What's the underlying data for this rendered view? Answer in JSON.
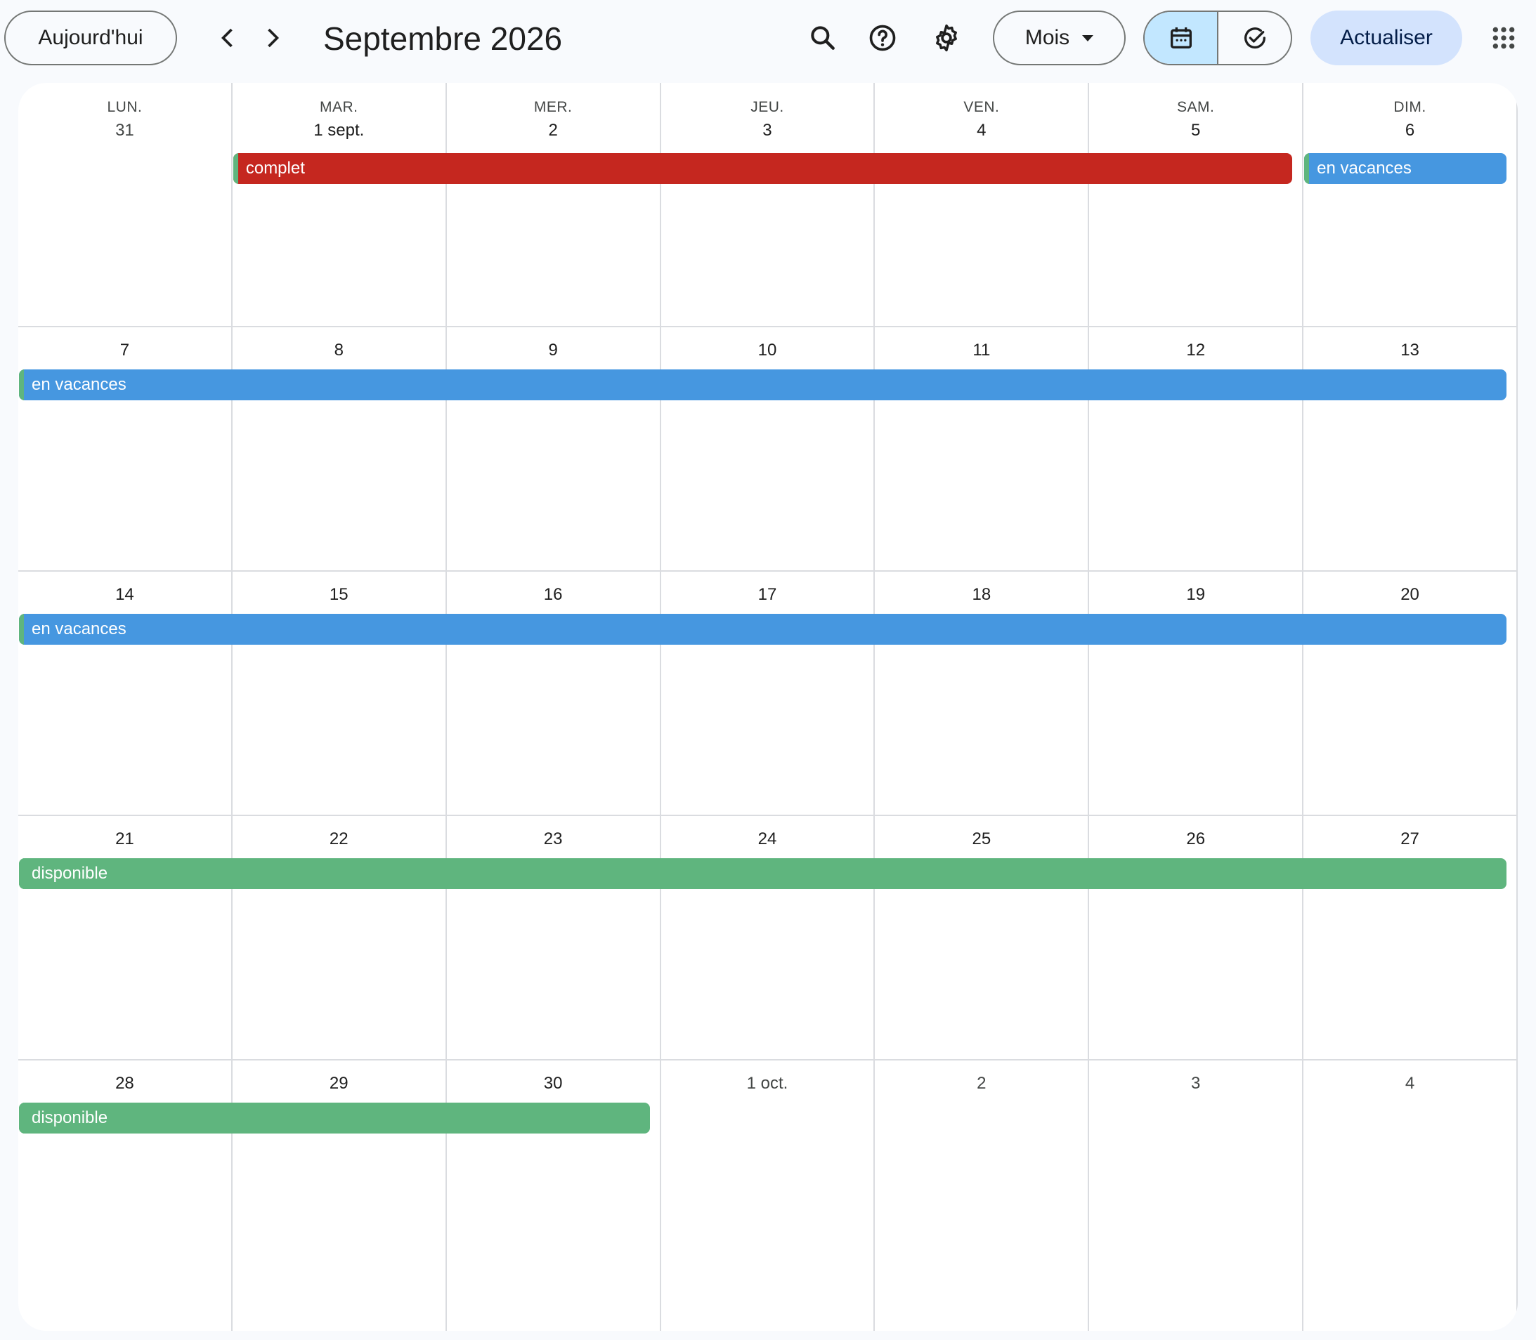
{
  "toolbar": {
    "today_label": "Aujourd'hui",
    "title": "Septembre 2026",
    "view_label": "Mois",
    "refresh_label": "Actualiser",
    "icons": [
      "chevron-left-icon",
      "chevron-right-icon",
      "search-icon",
      "help-icon",
      "gear-icon",
      "calendar-icon",
      "task-check-icon",
      "apps-grid-icon"
    ]
  },
  "colors": {
    "complet": "#c5271f",
    "vacances": "#4697e0",
    "disponible": "#5fb57e",
    "active_segment": "#c2e7ff",
    "refresh_button": "#d3e3fd"
  },
  "weekdays": [
    "LUN.",
    "MAR.",
    "MER.",
    "JEU.",
    "VEN.",
    "SAM.",
    "DIM."
  ],
  "weeks": [
    {
      "days": [
        {
          "label": "31",
          "other": true
        },
        {
          "label": "1 sept.",
          "other": false
        },
        {
          "label": "2",
          "other": false
        },
        {
          "label": "3",
          "other": false
        },
        {
          "label": "4",
          "other": false
        },
        {
          "label": "5",
          "other": false
        },
        {
          "label": "6",
          "other": false
        }
      ],
      "events": [
        {
          "title": "complet",
          "color": "complet",
          "start": 1,
          "end": 5
        },
        {
          "title": "en vacances",
          "color": "vacances",
          "start": 6,
          "end": 6
        }
      ]
    },
    {
      "days": [
        {
          "label": "7",
          "other": false
        },
        {
          "label": "8",
          "other": false
        },
        {
          "label": "9",
          "other": false
        },
        {
          "label": "10",
          "other": false
        },
        {
          "label": "11",
          "other": false
        },
        {
          "label": "12",
          "other": false
        },
        {
          "label": "13",
          "other": false
        }
      ],
      "events": [
        {
          "title": "en vacances",
          "color": "vacances",
          "start": 0,
          "end": 6
        }
      ]
    },
    {
      "days": [
        {
          "label": "14",
          "other": false
        },
        {
          "label": "15",
          "other": false
        },
        {
          "label": "16",
          "other": false
        },
        {
          "label": "17",
          "other": false
        },
        {
          "label": "18",
          "other": false
        },
        {
          "label": "19",
          "other": false
        },
        {
          "label": "20",
          "other": false
        }
      ],
      "events": [
        {
          "title": "en vacances",
          "color": "vacances",
          "start": 0,
          "end": 6
        }
      ]
    },
    {
      "days": [
        {
          "label": "21",
          "other": false
        },
        {
          "label": "22",
          "other": false
        },
        {
          "label": "23",
          "other": false
        },
        {
          "label": "24",
          "other": false
        },
        {
          "label": "25",
          "other": false
        },
        {
          "label": "26",
          "other": false
        },
        {
          "label": "27",
          "other": false
        }
      ],
      "events": [
        {
          "title": "disponible",
          "color": "disponible",
          "start": 0,
          "end": 6
        }
      ]
    },
    {
      "days": [
        {
          "label": "28",
          "other": false
        },
        {
          "label": "29",
          "other": false
        },
        {
          "label": "30",
          "other": false
        },
        {
          "label": "1 oct.",
          "other": true
        },
        {
          "label": "2",
          "other": true
        },
        {
          "label": "3",
          "other": true
        },
        {
          "label": "4",
          "other": true
        }
      ],
      "events": [
        {
          "title": "disponible",
          "color": "disponible",
          "start": 0,
          "end": 2
        }
      ]
    }
  ]
}
